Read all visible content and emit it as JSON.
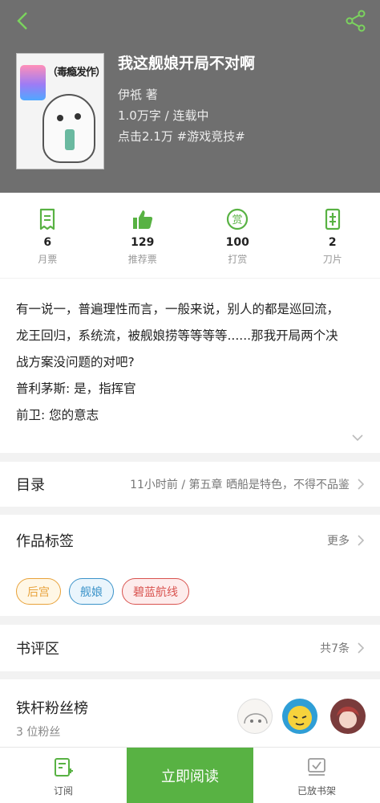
{
  "colors": {
    "accent": "#58b243",
    "hero_bg": "#6f6f6f"
  },
  "book": {
    "title": "我这舰娘开局不对啊",
    "author": "伊祇  著",
    "words_status": "1.0万字 / 连载中",
    "clicks_genre": "点击2.1万  #游戏竞技#",
    "cover_text": "（毒瘾发作）"
  },
  "stats": [
    {
      "icon": "monthly-ticket-icon",
      "value": "6",
      "label": "月票"
    },
    {
      "icon": "thumbs-up-icon",
      "value": "129",
      "label": "推荐票"
    },
    {
      "icon": "reward-icon",
      "value": "100",
      "label": "打赏"
    },
    {
      "icon": "blade-icon",
      "value": "2",
      "label": "刀片"
    }
  ],
  "intro": [
    "有一说一，普遍理性而言，一般来说，别人的都是巡回流，",
    "龙王回归，系统流，被舰娘捞等等等等......那我开局两个决",
    "战方案没问题的对吧?",
    "普利茅斯: 是，指挥官",
    "前卫: 您的意志"
  ],
  "catalog": {
    "title": "目录",
    "latest": "11小时前 / 第五章  晒船是特色，不得不品鉴"
  },
  "tags_section": {
    "title": "作品标签",
    "more": "更多"
  },
  "tags": [
    {
      "label": "后宫",
      "color": "#e8a23a",
      "bg": "#fff7e6"
    },
    {
      "label": "舰娘",
      "color": "#3b93c9",
      "bg": "#eaf5fc"
    },
    {
      "label": "碧蓝航线",
      "color": "#d9534f",
      "bg": "#fdecec"
    }
  ],
  "reviews": {
    "title": "书评区",
    "count": "共7条"
  },
  "fans": {
    "title": "铁杆粉丝榜",
    "count": "3 位粉丝"
  },
  "bottom": {
    "subscribe": "订阅",
    "read_now": "立即阅读",
    "on_shelf": "已放书架"
  }
}
